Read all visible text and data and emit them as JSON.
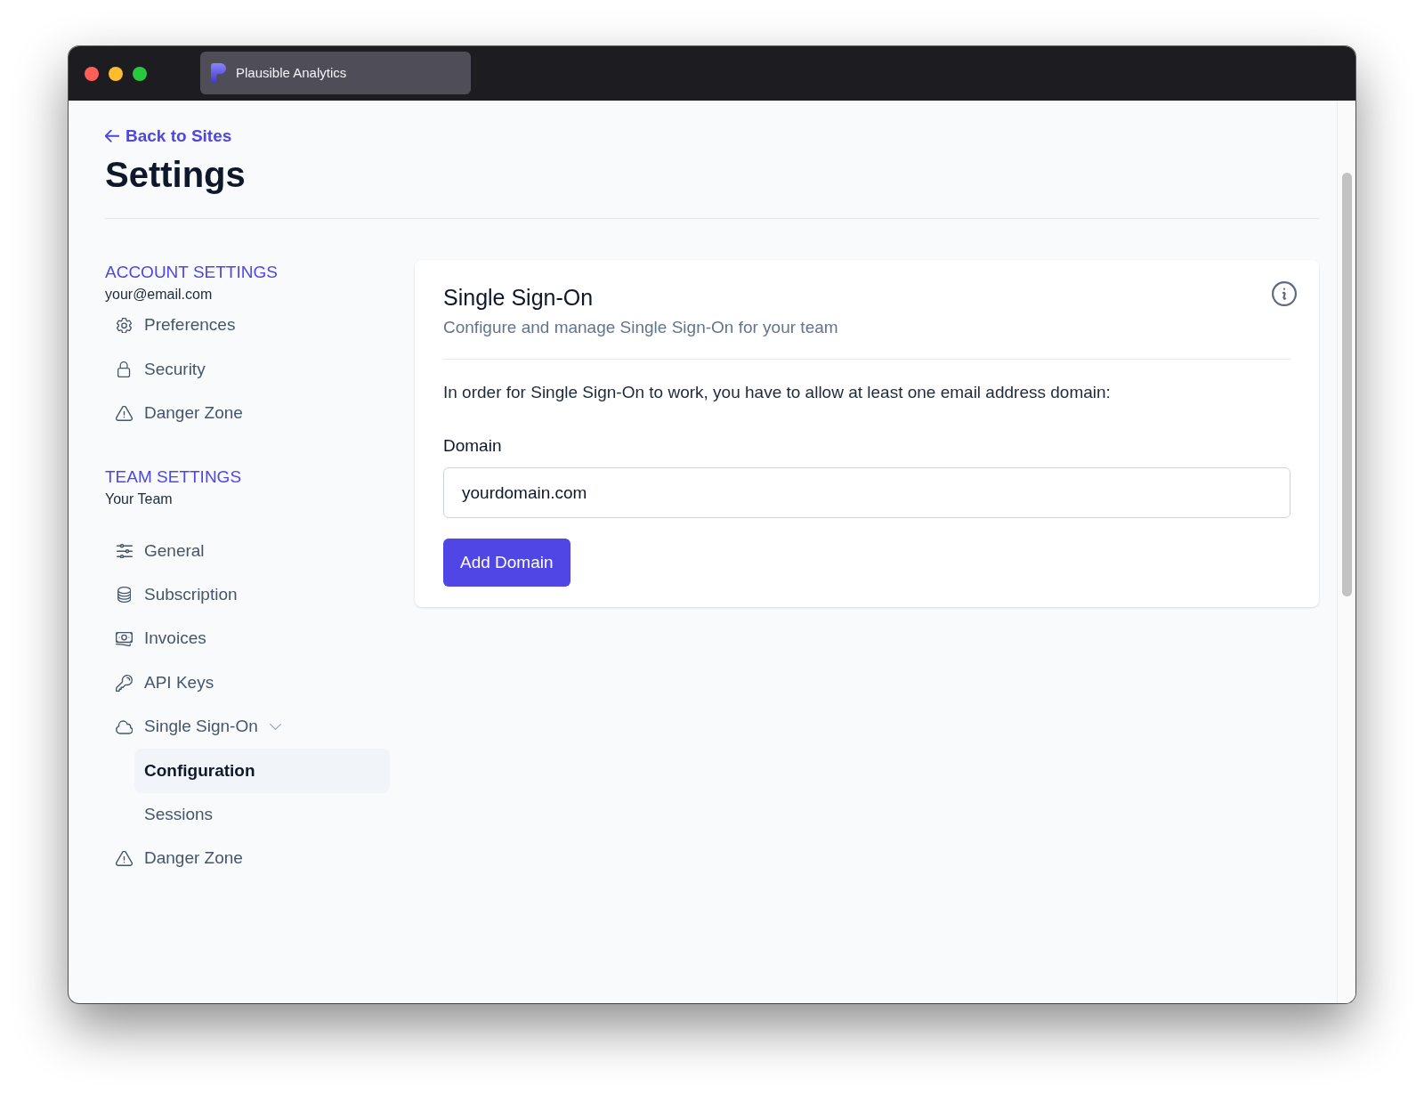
{
  "window": {
    "tab_title": "Plausible Analytics"
  },
  "back_link": "Back to Sites",
  "page_title": "Settings",
  "sidebar": {
    "sections": [
      {
        "heading": "ACCOUNT SETTINGS",
        "subtitle": "your@email.com",
        "items": [
          {
            "label": "Preferences",
            "selected": false
          },
          {
            "label": "Security",
            "selected": false
          },
          {
            "label": "Danger Zone",
            "selected": false
          }
        ]
      },
      {
        "heading": "TEAM SETTINGS",
        "subtitle": "Your Team",
        "items": [
          {
            "label": "General",
            "selected": false
          },
          {
            "label": "Subscription",
            "selected": false
          },
          {
            "label": "Invoices",
            "selected": false
          },
          {
            "label": "API Keys",
            "selected": false
          },
          {
            "label": "Single Sign-On",
            "selected": false,
            "expanded": true,
            "children": [
              {
                "label": "Configuration",
                "selected": true
              },
              {
                "label": "Sessions",
                "selected": false
              }
            ]
          },
          {
            "label": "Danger Zone",
            "selected": false
          }
        ]
      }
    ]
  },
  "card": {
    "title": "Single Sign-On",
    "subtitle": "Configure and manage Single Sign-On for your team",
    "message": "In order for Single Sign-On to work, you have to allow at least one email address domain:",
    "field": {
      "label": "Domain",
      "value": "yourdomain.com"
    },
    "button": "Add Domain"
  }
}
